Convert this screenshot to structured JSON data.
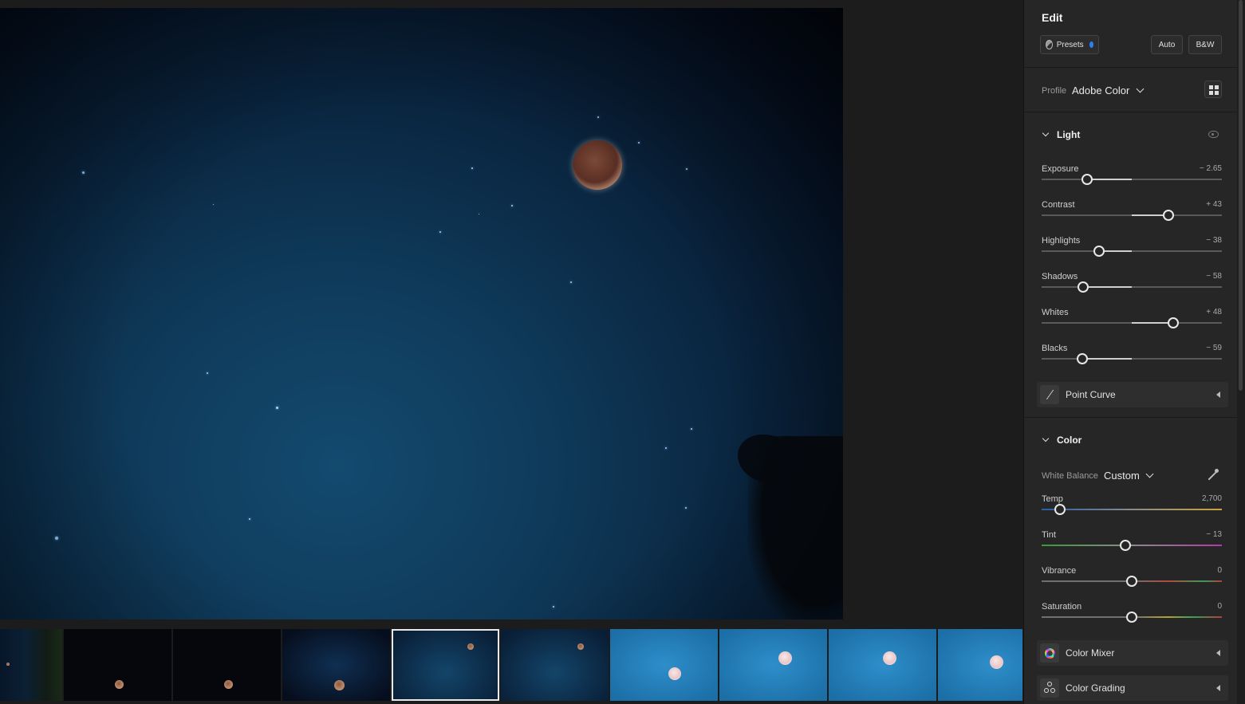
{
  "panel": {
    "title": "Edit",
    "presets_label": "Presets",
    "auto_label": "Auto",
    "bw_label": "B&W",
    "profile_label": "Profile",
    "profile_value": "Adobe Color"
  },
  "light": {
    "title": "Light",
    "sliders": [
      {
        "name": "Exposure",
        "value": "− 2.65",
        "pos": 0.25
      },
      {
        "name": "Contrast",
        "value": "+ 43",
        "pos": 0.705
      },
      {
        "name": "Highlights",
        "value": "− 38",
        "pos": 0.32
      },
      {
        "name": "Shadows",
        "value": "− 58",
        "pos": 0.23
      },
      {
        "name": "Whites",
        "value": "+ 48",
        "pos": 0.73
      },
      {
        "name": "Blacks",
        "value": "− 59",
        "pos": 0.225
      }
    ],
    "point_curve_label": "Point Curve"
  },
  "color": {
    "title": "Color",
    "white_balance_label": "White Balance",
    "white_balance_value": "Custom",
    "sliders": [
      {
        "name": "Temp",
        "value": "2,700",
        "pos": 0.1
      },
      {
        "name": "Tint",
        "value": "− 13",
        "pos": 0.465
      },
      {
        "name": "Vibrance",
        "value": "0",
        "pos": 0.5
      },
      {
        "name": "Saturation",
        "value": "0",
        "pos": 0.5
      }
    ],
    "color_mixer_label": "Color Mixer",
    "color_grading_label": "Color Grading"
  },
  "filmstrip": {
    "selected_index": 4,
    "count": 10
  }
}
